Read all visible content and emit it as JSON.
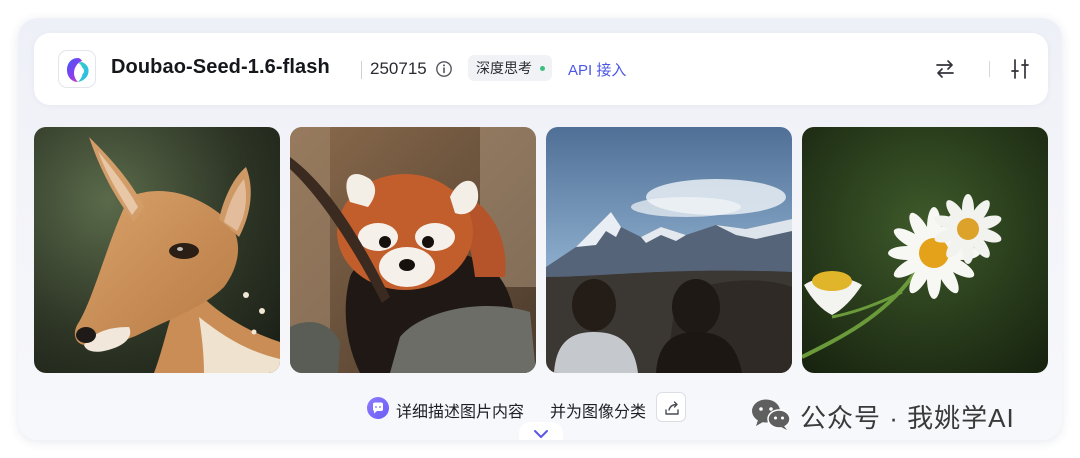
{
  "header": {
    "model_name": "Doubao-Seed-1.6-flash",
    "version": "250715",
    "think_label": "深度思考",
    "api_label": "API 接入"
  },
  "gallery": {
    "photos": [
      {
        "subject": "deer"
      },
      {
        "subject": "red-panda"
      },
      {
        "subject": "mountains-with-people"
      },
      {
        "subject": "daisies"
      }
    ]
  },
  "prompt": {
    "text1": "详细描述图片内容",
    "text2": "并为图像分类"
  },
  "watermark": {
    "text": "公众号 · 我姚学AI"
  },
  "colors": {
    "accent": "#4c57e6",
    "status_dot": "#3fbf7f",
    "prompt_icon": "#7b6cf8"
  },
  "icons": [
    "doubao-logo-icon",
    "info-icon",
    "swap-icon",
    "settings-icon",
    "chat-bubble-icon",
    "share-icon",
    "chevron-down-icon",
    "wechat-icon"
  ]
}
